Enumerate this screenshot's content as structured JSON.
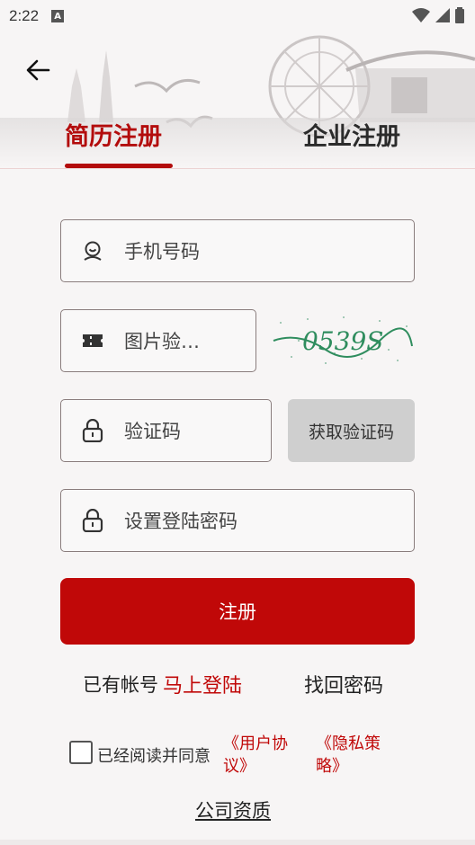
{
  "status_bar": {
    "time": "2:22",
    "notification_letter": "A"
  },
  "tabs": [
    {
      "label": "简历注册",
      "active": true
    },
    {
      "label": "企业注册",
      "active": false
    }
  ],
  "form": {
    "phone_placeholder": "手机号码",
    "image_code_placeholder": "图片验…",
    "captcha_text": "0539S",
    "sms_code_placeholder": "验证码",
    "get_code_label": "获取验证码",
    "password_placeholder": "设置登陆密码",
    "submit_label": "注册"
  },
  "links": {
    "have_account": "已有帐号",
    "login_now": "马上登陆",
    "forgot_password": "找回密码"
  },
  "agreement": {
    "text": "已经阅读并同意",
    "user_agreement": "《用户协议》",
    "privacy_policy": "《隐私策略》",
    "checked": false
  },
  "footer": {
    "qualification": "公司资质"
  },
  "colors": {
    "accent": "#c00808",
    "background": "#f7f5f5",
    "button_disabled": "#cfcfcf"
  }
}
